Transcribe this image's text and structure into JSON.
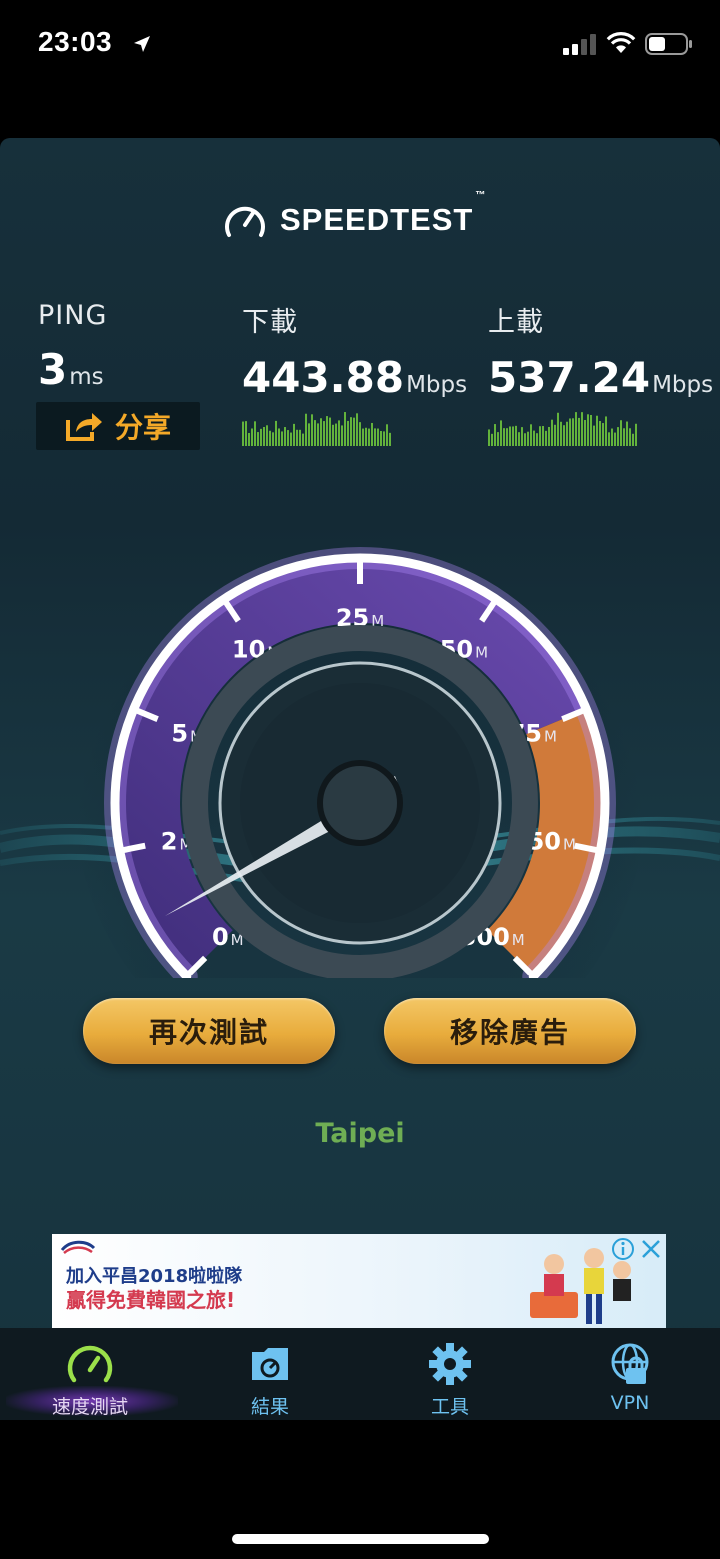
{
  "status": {
    "time": "23:03"
  },
  "header": {
    "logo": "SPEEDTEST",
    "trademark": "™"
  },
  "metrics": {
    "ping": {
      "label": "PING",
      "value": "3",
      "unit": "ms"
    },
    "download": {
      "label": "下載",
      "value": "443.88",
      "unit": "Mbps"
    },
    "upload": {
      "label": "上載",
      "value": "537.24",
      "unit": "Mbps"
    }
  },
  "share_button": {
    "label": "分享"
  },
  "gauge": {
    "ticks": [
      {
        "value": "0",
        "unit": "M"
      },
      {
        "value": "2",
        "unit": "M"
      },
      {
        "value": "5",
        "unit": "M"
      },
      {
        "value": "10",
        "unit": "M"
      },
      {
        "value": "25",
        "unit": "M"
      },
      {
        "value": "50",
        "unit": "M"
      },
      {
        "value": "75",
        "unit": "M"
      },
      {
        "value": "150",
        "unit": "M"
      },
      {
        "value": "300",
        "unit": "M"
      }
    ],
    "colors": {
      "left": "#6a3fb0",
      "right": "#d07a3a"
    }
  },
  "actions": {
    "retest": "再次測試",
    "remove_ads": "移除廣告"
  },
  "server": {
    "location": "Taipei"
  },
  "ad": {
    "line1": "加入平昌2018啦啦隊",
    "line2": "贏得免費韓國之旅!"
  },
  "tabs": [
    {
      "label": "速度測試",
      "icon": "speedometer-icon",
      "active": true
    },
    {
      "label": "結果",
      "icon": "results-folder-icon",
      "active": false
    },
    {
      "label": "工具",
      "icon": "gear-icon",
      "active": false
    },
    {
      "label": "VPN",
      "icon": "vpn-globe-icon",
      "active": false
    }
  ],
  "colors": {
    "accent_gold": "#f4a928",
    "location_green": "#6fae54",
    "tab_blue": "#6ec2f0"
  }
}
